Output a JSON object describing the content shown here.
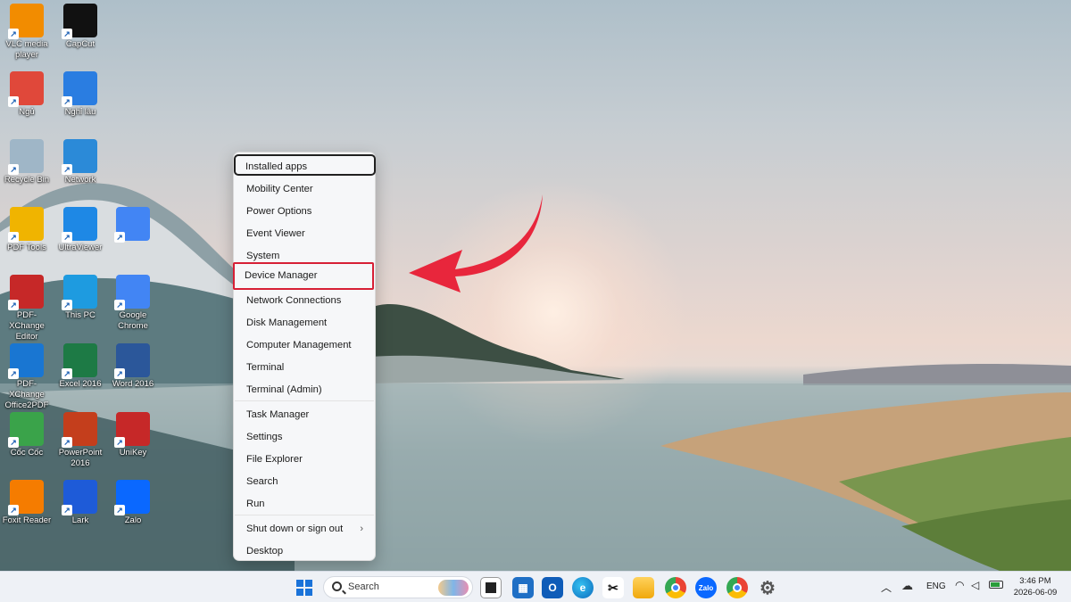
{
  "desktop_icons": [
    {
      "label": "VLC media player",
      "icon": "vlc-cone-icon",
      "color": "#f28c00"
    },
    {
      "label": "CapCut",
      "icon": "capcut-icon",
      "color": "#111111"
    },
    {
      "label": "Ngủ",
      "icon": "power-icon",
      "color": "#e0483a"
    },
    {
      "label": "Nghỉ lâu",
      "icon": "document-icon",
      "color": "#2a7de1"
    },
    {
      "label": "Recycle Bin",
      "icon": "recycle-bin-icon",
      "color": "#9fb6c7"
    },
    {
      "label": "Network",
      "icon": "network-monitor-icon",
      "color": "#2b8ad8"
    },
    {
      "label": "PDF Tools",
      "icon": "pdf-tools-icon",
      "color": "#f0b400"
    },
    {
      "label": "UltraViewer",
      "icon": "ultraviewer-icon",
      "color": "#1e88e5"
    },
    {
      "label": "",
      "icon": "chrome-profile-icon",
      "color": "#4285f4"
    },
    {
      "label": "PDF-XChange Editor",
      "icon": "pdf-xchange-editor-icon",
      "color": "#c62828"
    },
    {
      "label": "This PC",
      "icon": "monitor-icon",
      "color": "#1e9be0"
    },
    {
      "label": "Google Chrome",
      "icon": "chrome-icon",
      "color": "#4285f4"
    },
    {
      "label": "PDF-XChange Office2PDF",
      "icon": "pdf-xchange-office-icon",
      "color": "#1976d2"
    },
    {
      "label": "Excel 2016",
      "icon": "excel-icon",
      "color": "#1d7a45"
    },
    {
      "label": "Word 2016",
      "icon": "word-icon",
      "color": "#2b579a"
    },
    {
      "label": "Cốc Cốc",
      "icon": "coccoc-icon",
      "color": "#3aa34a"
    },
    {
      "label": "PowerPoint 2016",
      "icon": "powerpoint-icon",
      "color": "#c43e1c"
    },
    {
      "label": "UniKey",
      "icon": "unikey-icon",
      "color": "#c62828"
    },
    {
      "label": "Foxit Reader",
      "icon": "foxit-icon",
      "color": "#f57c00"
    },
    {
      "label": "Lark",
      "icon": "lark-icon",
      "color": "#1e5bd8"
    },
    {
      "label": "Zalo",
      "icon": "zalo-icon",
      "color": "#0a68ff"
    }
  ],
  "menu": {
    "items": [
      {
        "label": "Installed apps"
      },
      {
        "label": "Mobility Center"
      },
      {
        "label": "Power Options"
      },
      {
        "label": "Event Viewer"
      },
      {
        "label": "System"
      },
      {
        "label": "Device Manager"
      },
      {
        "label": "Network Connections"
      },
      {
        "label": "Disk Management"
      },
      {
        "label": "Computer Management"
      },
      {
        "label": "Terminal"
      },
      {
        "label": "Terminal (Admin)"
      },
      {
        "label": "Task Manager"
      },
      {
        "label": "Settings"
      },
      {
        "label": "File Explorer"
      },
      {
        "label": "Search"
      },
      {
        "label": "Run"
      },
      {
        "label": "Shut down or sign out"
      },
      {
        "label": "Desktop"
      }
    ],
    "focused_item": "Installed apps",
    "highlighted_item": "Device Manager",
    "highlight_color": "#d71f35",
    "submenu_glyph": "›"
  },
  "annotation": {
    "arrow_color": "#e8263c"
  },
  "taskbar": {
    "search_placeholder": "Search",
    "language": "ENG",
    "time": "3:46 PM",
    "date": "2026-06-09",
    "icons": [
      "windows-start-icon",
      "task-view-icon",
      "store-icon",
      "outlook-icon",
      "edge-icon",
      "capcut-icon",
      "file-explorer-icon",
      "chrome-profile-t-icon",
      "zalo-icon",
      "chrome-profile-n-icon",
      "settings-gear-icon"
    ]
  }
}
